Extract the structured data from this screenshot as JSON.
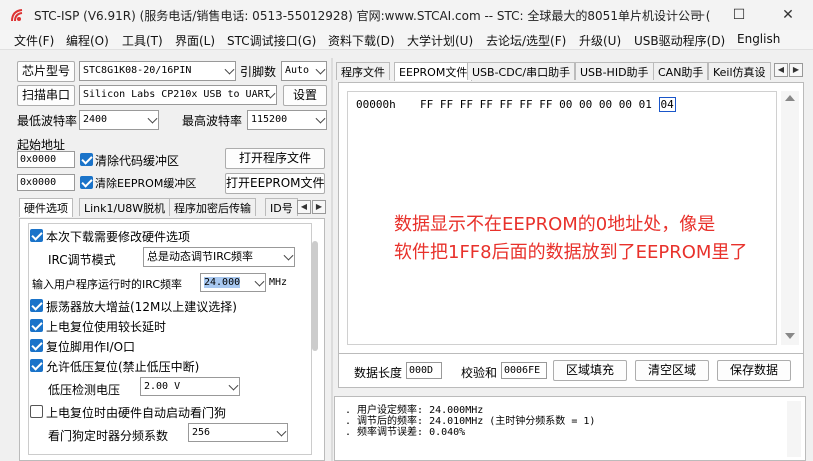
{
  "window": {
    "title": "STC-ISP (V6.91R) (服务电话/销售电话: 0513-55012928) 官网:www.STCAI.com  -- STC: 全球最大的8051单片机设计公司 (",
    "minimize": "—",
    "maximize": "☐",
    "close": "✕"
  },
  "menu": [
    "文件(F)",
    "编程(O)",
    "工具(T)",
    "界面(L)",
    "STC调试接口(G)",
    "资料下载(D)",
    "大学计划(U)",
    "去论坛/选型(F)",
    "升级(U)",
    "USB驱动程序(D)",
    "English"
  ],
  "left": {
    "chip_btn": "芯片型号",
    "chip_value": "STC8G1K08-20/16PIN",
    "pin_label": "引脚数",
    "pin_value": "Auto",
    "scan_btn": "扫描串口",
    "port_value": "Silicon Labs CP210x USB to UART",
    "settings_btn": "设置",
    "min_baud_label": "最低波特率",
    "min_baud_value": "2400",
    "max_baud_label": "最高波特率",
    "max_baud_value": "115200",
    "start_addr_label": "起始地址",
    "addr1": "0x0000",
    "clear_code_label": "清除代码缓冲区",
    "open_prog_btn": "打开程序文件",
    "addr2": "0x0000",
    "clear_eeprom_label": "清除EEPROM缓冲区",
    "open_eeprom_btn": "打开EEPROM文件",
    "tabs": [
      "硬件选项",
      "Link1/U8W脱机",
      "程序加密后传输",
      "ID号"
    ],
    "options": {
      "modify_hw": "本次下载需要修改硬件选项",
      "irc_mode_label": "IRC调节模式",
      "irc_mode_value": "总是动态调节IRC频率",
      "irc_freq_label": "输入用户程序运行时的IRC频率",
      "irc_freq_value": "24.000",
      "irc_unit": "MHz",
      "amp_gain": "振荡器放大增益(12M以上建议选择)",
      "power_delay": "上电复位使用较长延时",
      "reset_io": "复位脚用作I/O口",
      "low_volt_reset": "允许低压复位(禁止低压中断)",
      "low_volt_label": "低压检测电压",
      "low_volt_value": "2.00 V",
      "watchdog": "上电复位时由硬件自动启动看门狗",
      "wdt_label": "看门狗定时器分频系数",
      "wdt_value": "256"
    }
  },
  "right": {
    "tabs": [
      "程序文件",
      "EEPROM文件",
      "USB-CDC/串口助手",
      "USB-HID助手",
      "CAN助手",
      "Keil仿真设"
    ],
    "hex_addr": "00000h",
    "hex_bytes": [
      "FF",
      "FF",
      "FF",
      "FF",
      "FF",
      "FF",
      "FF",
      "00",
      "00",
      "00",
      "00",
      "01",
      "04"
    ],
    "annotation_line1": "数据显示不在EEPROM的0地址处，像是",
    "annotation_line2": "软件把1FF8后面的数据放到了EEPROM里了",
    "data_len_label": "数据长度",
    "data_len_value": "000D",
    "checksum_label": "校验和",
    "checksum_value": "0006FE",
    "fill_btn": "区域填充",
    "clear_btn": "清空区域",
    "save_btn": "保存数据",
    "log_lines": [
      ". 用户设定频率: 24.000MHz",
      ". 调节后的频率: 24.010MHz (主时钟分频系数 = 1)",
      ". 频率调节误差: 0.040%"
    ]
  },
  "colors": {
    "annotation": "#e8312b",
    "selected_byte_border": "#1a56c9",
    "checkbox_accent": "#1a73c9"
  }
}
